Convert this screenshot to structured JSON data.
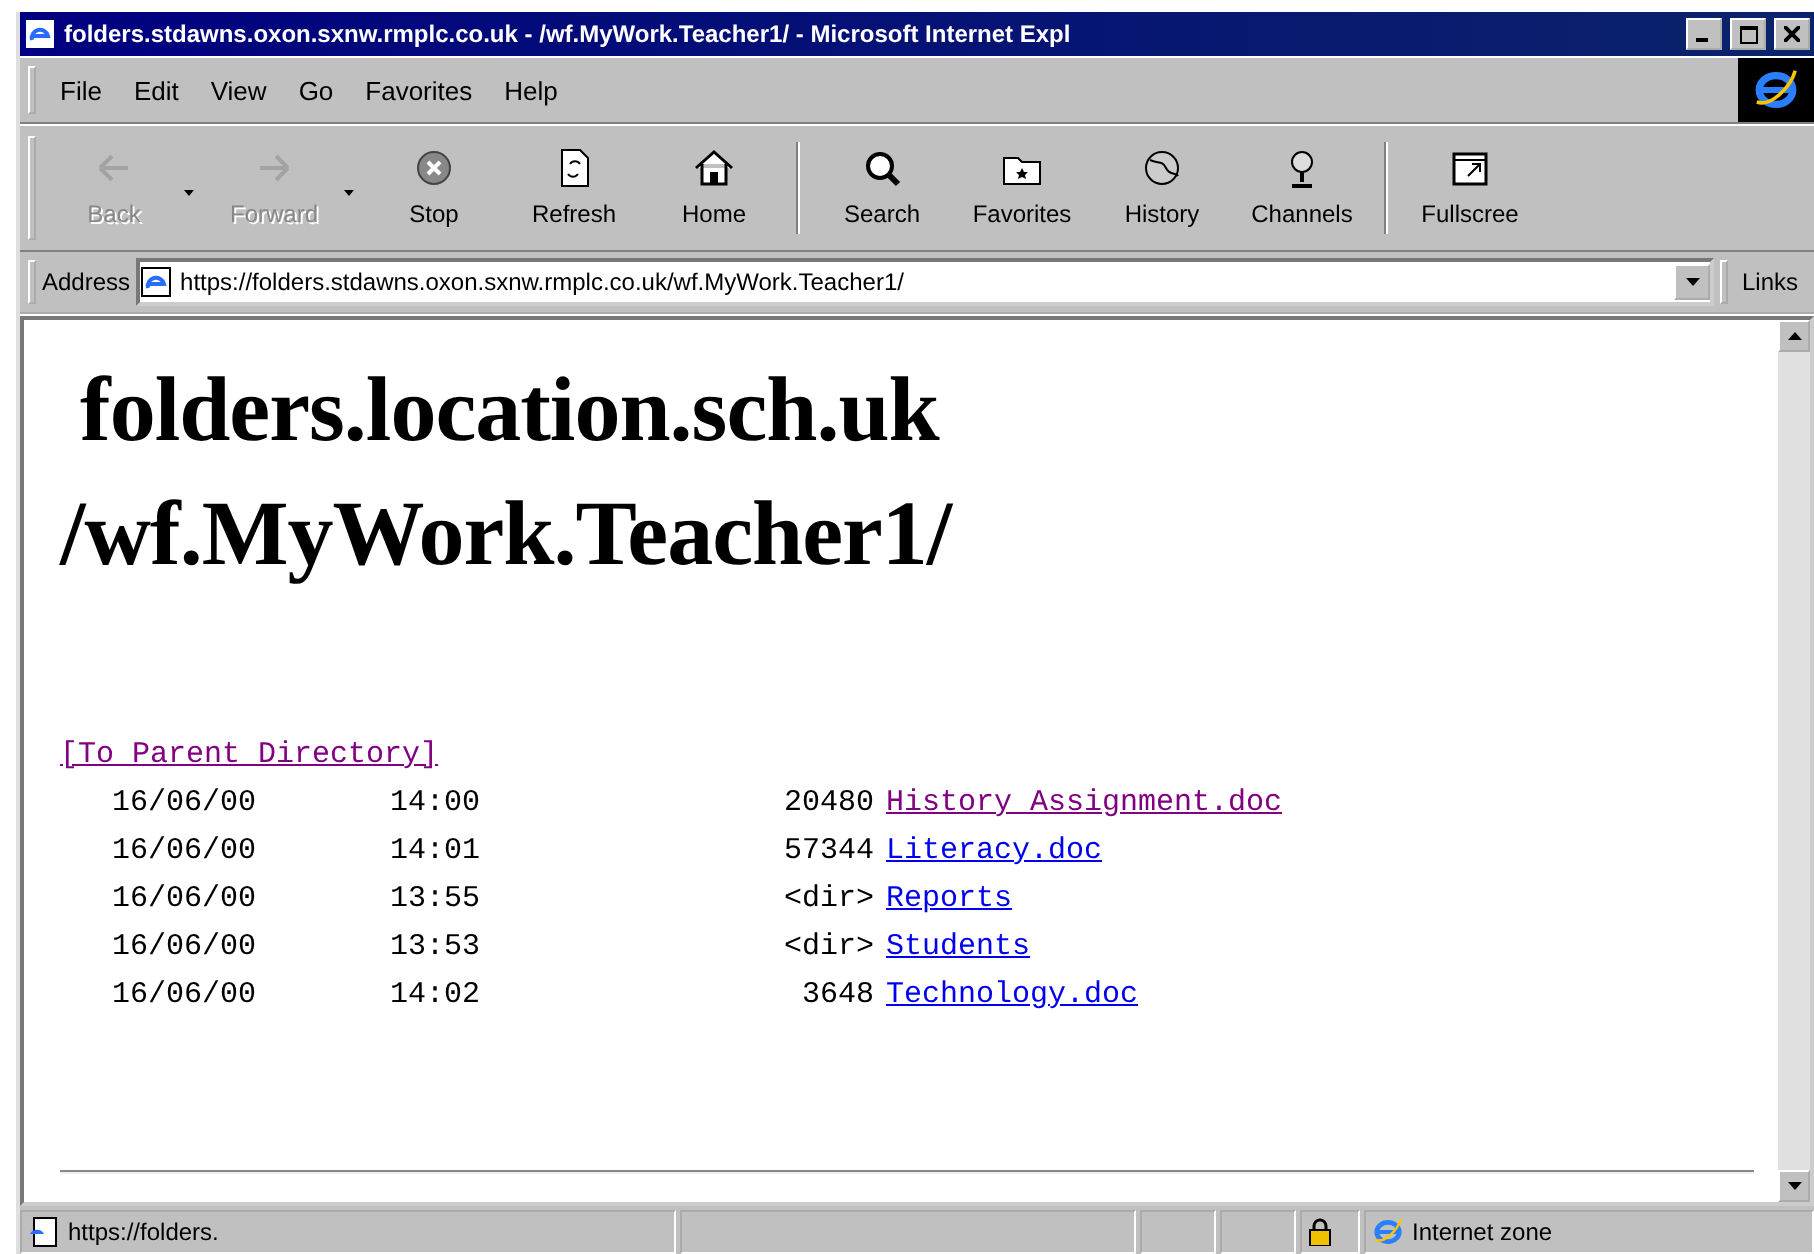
{
  "window": {
    "title": "folders.stdawns.oxon.sxnw.rmplc.co.uk - /wf.MyWork.Teacher1/ - Microsoft Internet Expl"
  },
  "menu": [
    "File",
    "Edit",
    "View",
    "Go",
    "Favorites",
    "Help"
  ],
  "toolbar": {
    "groups": [
      [
        {
          "label": "Back",
          "disabled": true,
          "has_menu": true
        },
        {
          "label": "Forward",
          "disabled": true,
          "has_menu": true
        },
        {
          "label": "Stop",
          "disabled": false,
          "has_menu": false
        },
        {
          "label": "Refresh",
          "disabled": false,
          "has_menu": false
        },
        {
          "label": "Home",
          "disabled": false,
          "has_menu": false
        }
      ],
      [
        {
          "label": "Search",
          "disabled": false,
          "has_menu": false
        },
        {
          "label": "Favorites",
          "disabled": false,
          "has_menu": false
        },
        {
          "label": "History",
          "disabled": false,
          "has_menu": false
        },
        {
          "label": "Channels",
          "disabled": false,
          "has_menu": false
        }
      ],
      [
        {
          "label": "Fullscree",
          "disabled": false,
          "has_menu": false
        }
      ]
    ]
  },
  "address": {
    "label": "Address",
    "value": "https://folders.stdawns.oxon.sxnw.rmplc.co.uk/wf.MyWork.Teacher1/",
    "links_label": "Links"
  },
  "page": {
    "heading": [
      "folders.location.sch.uk",
      "/wf.MyWork.Teacher1/"
    ],
    "parent_link": {
      "text": "[To Parent Directory]",
      "visited": true
    },
    "rows": [
      {
        "date": "16/06/00",
        "time": "14:00",
        "size": "20480",
        "name": "History Assignment.doc",
        "visited": true
      },
      {
        "date": "16/06/00",
        "time": "14:01",
        "size": "57344",
        "name": "Literacy.doc",
        "visited": false
      },
      {
        "date": "16/06/00",
        "time": "13:55",
        "size": "<dir>",
        "name": "Reports",
        "visited": false
      },
      {
        "date": "16/06/00",
        "time": "13:53",
        "size": "<dir>",
        "name": "Students",
        "visited": false
      },
      {
        "date": "16/06/00",
        "time": "14:02",
        "size": "3648",
        "name": "Technology.doc",
        "visited": false
      }
    ]
  },
  "status_bar": {
    "text": "https://folders.",
    "zone": "Internet zone",
    "secure": true
  }
}
